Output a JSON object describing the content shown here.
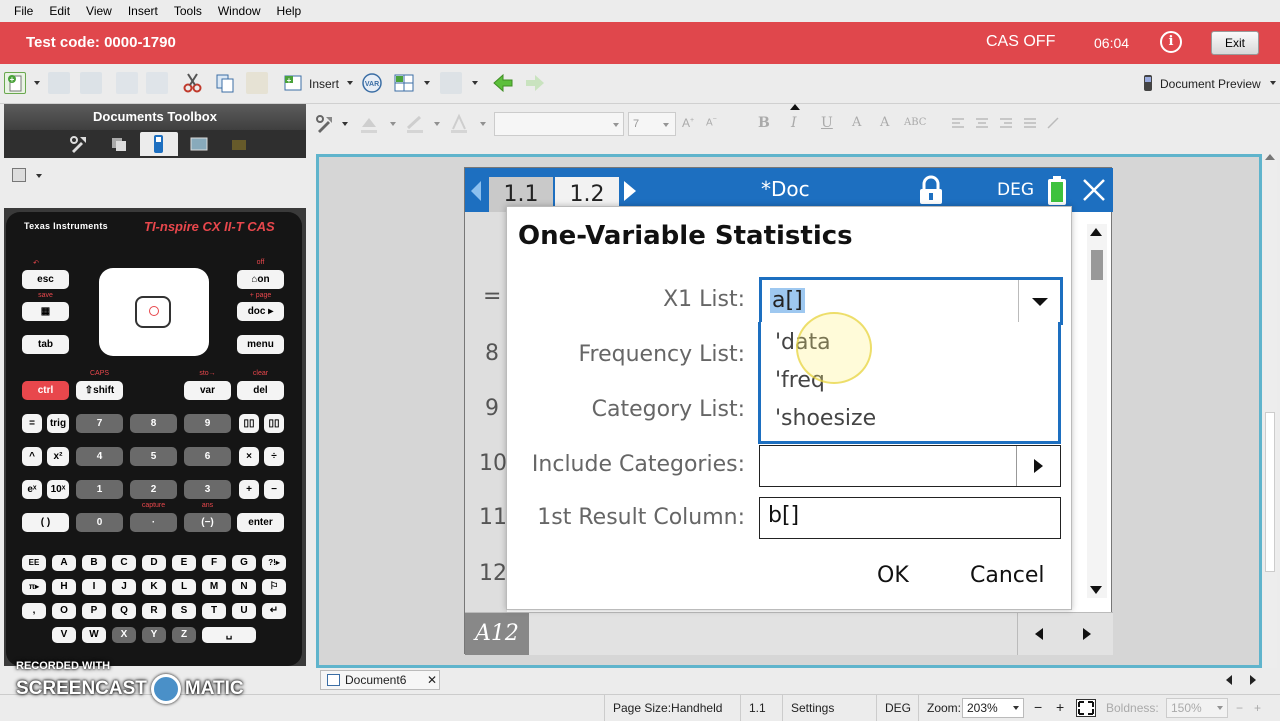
{
  "menu": [
    "File",
    "Edit",
    "View",
    "Insert",
    "Tools",
    "Window",
    "Help"
  ],
  "header": {
    "test_code": "Test code:  0000-1790",
    "cas_status": "CAS OFF",
    "time": "06:04",
    "info_glyph": "i",
    "exit_label": "Exit"
  },
  "toolbar": {
    "insert_label": "Insert",
    "document_preview_label": "Document Preview",
    "font_size_value": "7"
  },
  "format_glyphs": {
    "bold": "B",
    "italic": "I",
    "underline": "U",
    "case_a": "A",
    "subscript": "A",
    "abc": "ABC"
  },
  "sidebar": {
    "title": "Documents Toolbox"
  },
  "handheld": {
    "brand": "Texas Instruments",
    "model": "TI-nspire CX II-T CAS",
    "keys": {
      "esc": "esc",
      "home": "⌂on",
      "scratch": "▦",
      "doc": "doc ▸",
      "tab": "tab",
      "menu": "menu",
      "ctrl": "ctrl",
      "shift": "⇧shift",
      "var": "var",
      "del": "del",
      "eq": "=",
      "trig": "trig",
      "k7": "7",
      "k8": "8",
      "k9": "9",
      "tmpl": "▯▯",
      "cat": "▯▯",
      "caret": "^",
      "sq": "x²",
      "k4": "4",
      "k5": "5",
      "k6": "6",
      "mul": "×",
      "div": "÷",
      "ex": "eˣ",
      "tenx": "10ˣ",
      "k1": "1",
      "k2": "2",
      "k3": "3",
      "plus": "+",
      "minus": "−",
      "paren": "(  )",
      "k0": "0",
      "dot": "·",
      "neg": "(−)",
      "enter": "enter",
      "ee": "EE",
      "pi": "π▸",
      "comma": ",",
      "space": "␣",
      "letters_r1": [
        "A",
        "B",
        "C",
        "D",
        "E",
        "F",
        "G",
        "?!▸"
      ],
      "letters_r2": [
        "H",
        "I",
        "J",
        "K",
        "L",
        "M",
        "N",
        "⚐"
      ],
      "letters_r3": [
        "O",
        "P",
        "Q",
        "R",
        "S",
        "T",
        "U",
        "↵"
      ],
      "letters_r4": [
        "V",
        "W",
        "X",
        "Y",
        "Z"
      ]
    },
    "sublabels": {
      "off": "off",
      "save": "save",
      "page": "+ page",
      "caps": "CAPS",
      "sto": "sto→",
      "clear": "clear",
      "capture": "capture",
      "ans": "ans"
    }
  },
  "calculator": {
    "tabs": [
      "1.1",
      "1.2"
    ],
    "doc_title": "*Doc",
    "angle_mode": "DEG",
    "row_labels": [
      "=",
      "8",
      "9",
      "10",
      "11",
      "12"
    ],
    "cell_ref": "A12"
  },
  "dialog": {
    "title": "One-Variable Statistics",
    "fields": [
      {
        "label": "X1 List:",
        "value": "a[]"
      },
      {
        "label": "Frequency List:",
        "value": ""
      },
      {
        "label": "Category List:",
        "value": ""
      },
      {
        "label": "Include Categories:",
        "value": ""
      },
      {
        "label": "1st Result Column:",
        "value": "b[]"
      }
    ],
    "dropdown_options": [
      "'data",
      "'freq",
      "'shoesize"
    ],
    "ok_label": "OK",
    "cancel_label": "Cancel"
  },
  "document_tab": {
    "name": "Document6",
    "close_glyph": "✕"
  },
  "statusbar": {
    "page_size": "Page Size:Handheld",
    "page": "1.1",
    "settings": "Settings",
    "angle": "DEG",
    "zoom_label": "Zoom:",
    "zoom_value": "203%",
    "minus": "−",
    "plus": "+",
    "boldness_label": "Boldness:",
    "boldness_value": "150%"
  },
  "watermark": {
    "line1": "RECORDED WITH",
    "line2": "SCREENCAST",
    "line3": "MATIC"
  }
}
